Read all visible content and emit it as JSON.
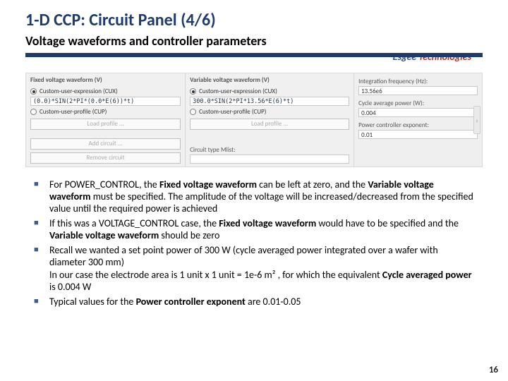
{
  "header": {
    "title": "1-D CCP: Circuit Panel (4/6)",
    "subtitle": "Voltage waveforms and controller parameters",
    "brand_part1": "Esgee",
    "brand_part2": " Technologies"
  },
  "panel": {
    "fixed": {
      "heading": "Fixed voltage waveform (V)",
      "radio_cux": "Custom-user-expression (CUX)",
      "expr": "(0.0)*SIN(2*PI*(0.0*E(6))*t)",
      "radio_cup": "Custom-user-profile (CUP)",
      "load": "Load profile ...",
      "add": "Add circuit ...",
      "remove": "Remove circuit"
    },
    "variable": {
      "heading": "Variable voltage waveform (V)",
      "radio_cux": "Custom-user-expression (CUX)",
      "expr": "300.0*SIN(2*PI*13.56*E(6)*t)",
      "radio_cup": "Custom-user-profile (CUP)",
      "load": "Load profile ...",
      "mlist_label": "Circuit type Mlist:",
      "mlist_value": ""
    },
    "right": {
      "intfreq_label": "Integration frequency (Hz):",
      "intfreq_value": "13.56e6",
      "cyclepw_label": "Cycle average power (W):",
      "cyclepw_value": "0.004",
      "pcexp_label": "Power controller exponent:",
      "pcexp_value": "0.01"
    },
    "chevron": "›"
  },
  "notes": {
    "b1_a": "For POWER_CONTROL, the ",
    "b1_b": "Fixed voltage waveform",
    "b1_c": " can be left at zero, and the ",
    "b1_d": "Variable voltage waveform",
    "b1_e": " must be specified. The amplitude of the voltage will be increased/decreased from the specified value until the required power is achieved",
    "b2_a": "If this was a VOLTAGE_CONTROL case, the ",
    "b2_b": "Fixed voltage waveform",
    "b2_c": " would have to be specified and the ",
    "b2_d": "Variable voltage waveform",
    "b2_e": " should be zero",
    "b3_a": "Recall we wanted a set point power of 300 W (cycle averaged power integrated over a wafer with diameter 300 mm)",
    "b3_b": "In our case the electrode area is 1 unit x 1 unit = 1e-6 m² , for which the equivalent ",
    "b3_c": "Cycle averaged power",
    "b3_d": " is 0.004 W",
    "b4_a": "Typical values for the ",
    "b4_b": "Power controller exponent",
    "b4_c": " are 0.01-0.05"
  },
  "page_number": "16"
}
